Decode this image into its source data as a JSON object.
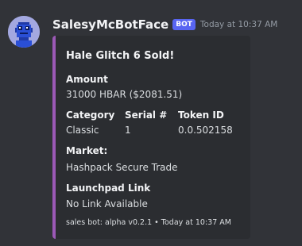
{
  "message": {
    "username": "SalesyMcBotFace",
    "badge": "BOT",
    "timestamp": "Today at 10:37 AM",
    "avatar_icon": "pixel-robot-avatar-icon",
    "embed": {
      "accent_color": "#9b59b6",
      "title": "Hale Glitch 6 Sold!",
      "fields": {
        "amount": {
          "name": "Amount",
          "value": "31000 HBAR ($2081.51)"
        },
        "category": {
          "name": "Category",
          "value": "Classic"
        },
        "serial": {
          "name": "Serial #",
          "value": "1"
        },
        "token_id": {
          "name": "Token ID",
          "value": "0.0.502158"
        },
        "market": {
          "name": "Market:",
          "value": "Hashpack Secure Trade"
        },
        "launchpad": {
          "name": "Launchpad Link",
          "value": "No Link Available"
        }
      },
      "footer": "sales bot: alpha v0.2.1 • Today at 10:37 AM"
    }
  }
}
